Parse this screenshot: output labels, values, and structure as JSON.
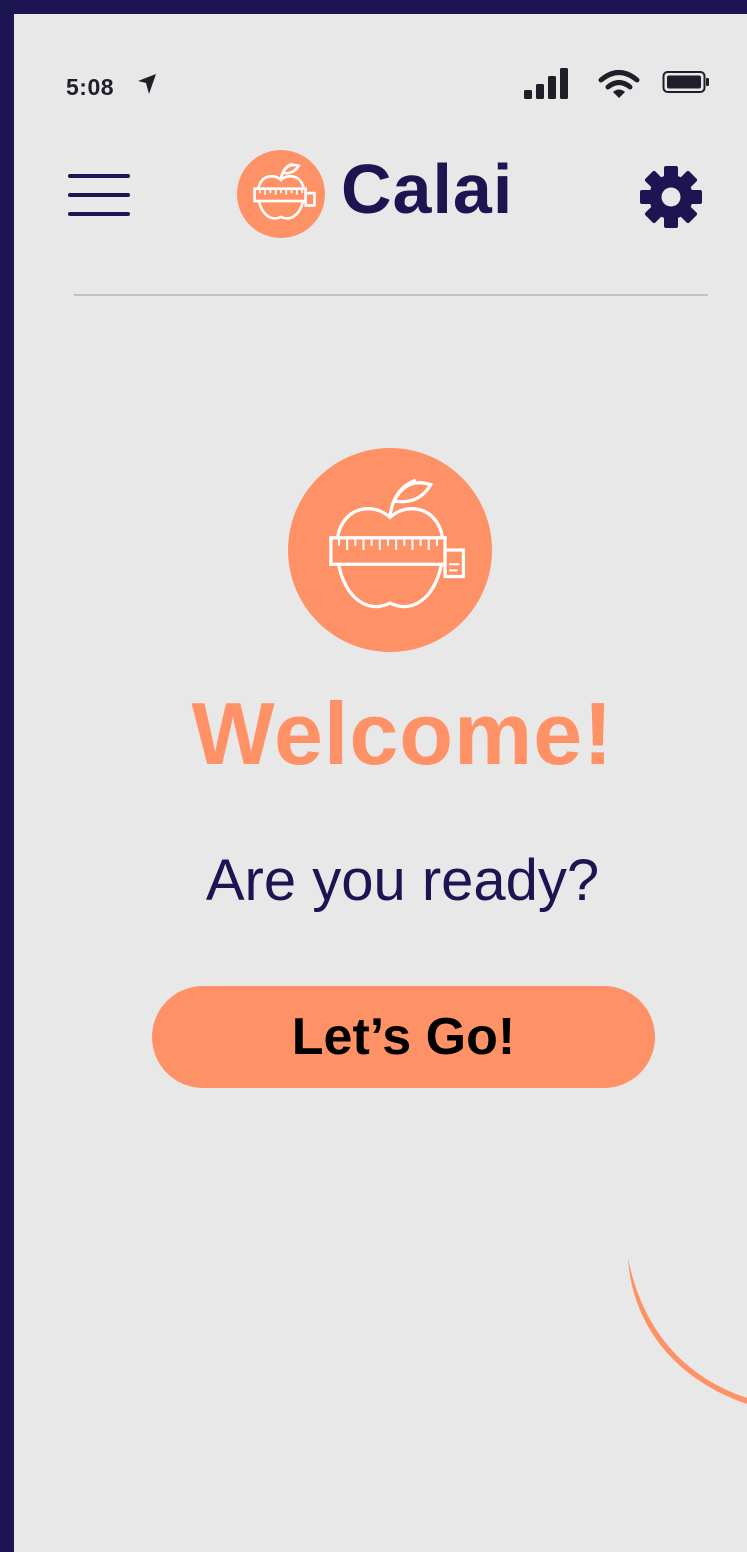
{
  "status_bar": {
    "time": "5:08"
  },
  "header": {
    "brand_name": "Calai",
    "menu_icon": "hamburger-menu-icon",
    "settings_icon": "gear-icon"
  },
  "hero": {
    "title": "Welcome!",
    "subtitle": "Are you ready?",
    "cta_label": "Let’s Go!",
    "icon": "apple-measuring-tape-icon"
  },
  "colors": {
    "accent": "#ff9166",
    "brand": "#1c1552",
    "background": "#e9e8e9",
    "frame": "#1c1552"
  }
}
